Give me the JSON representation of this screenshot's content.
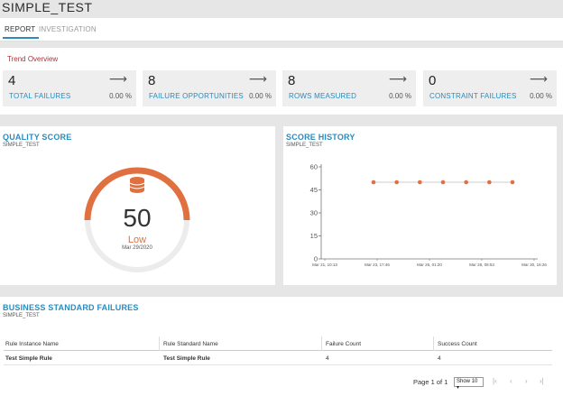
{
  "page": {
    "title": "SIMPLE_TEST"
  },
  "tabs": [
    {
      "label": "REPORT",
      "active": true
    },
    {
      "label": "INVESTIGATION",
      "active": false
    }
  ],
  "trend": {
    "title": "Trend Overview",
    "kpis": [
      {
        "value": "4",
        "label": "TOTAL FAILURES",
        "pct": "0.00 %",
        "icon": "arrow-right-icon"
      },
      {
        "value": "8",
        "label": "FAILURE OPPORTUNITIES",
        "pct": "0.00 %",
        "icon": "arrow-right-icon"
      },
      {
        "value": "8",
        "label": "ROWS MEASURED",
        "pct": "0.00 %",
        "icon": "arrow-right-icon"
      },
      {
        "value": "0",
        "label": "CONSTRAINT FAILURES",
        "pct": "0.00 %",
        "icon": "arrow-right-icon"
      }
    ]
  },
  "quality": {
    "title": "QUALITY SCORE",
    "subtitle": "SIMPLE_TEST",
    "score": "50",
    "score_fraction": 0.5,
    "rating": "Low",
    "date": "Mar 29/2020",
    "icon": "database-icon",
    "colors": {
      "arc": "#e07040",
      "track": "#ececec"
    }
  },
  "history": {
    "title": "SCORE HISTORY",
    "subtitle": "SIMPLE_TEST"
  },
  "chart_data": {
    "type": "line",
    "x": [
      "Mar 23, 17:46",
      "",
      "",
      "",
      "",
      "",
      ""
    ],
    "xticks": [
      "Mar 21, 10:13",
      "Mar 23, 17:46",
      "Mar 26, 01:20",
      "Mar 28, 08:53",
      "Mar 30, 16:26"
    ],
    "yticks": [
      "0",
      "15",
      "30",
      "45",
      "60"
    ],
    "values": [
      50,
      50,
      50,
      50,
      50,
      50,
      50
    ],
    "ylim": [
      0,
      60
    ],
    "series_color": "#e07040",
    "grid": false
  },
  "bsf": {
    "title": "BUSINESS STANDARD FAILURES",
    "subtitle": "SIMPLE_TEST",
    "columns": [
      "Rule Instance Name",
      "Rule Standard Name",
      "Failure Count",
      "Success Count"
    ],
    "rows": [
      [
        "Test Simple Rule",
        "Test Simple Rule",
        "4",
        "4"
      ]
    ],
    "pager": {
      "text": "Page 1 of 1",
      "show": "Show 10"
    }
  }
}
